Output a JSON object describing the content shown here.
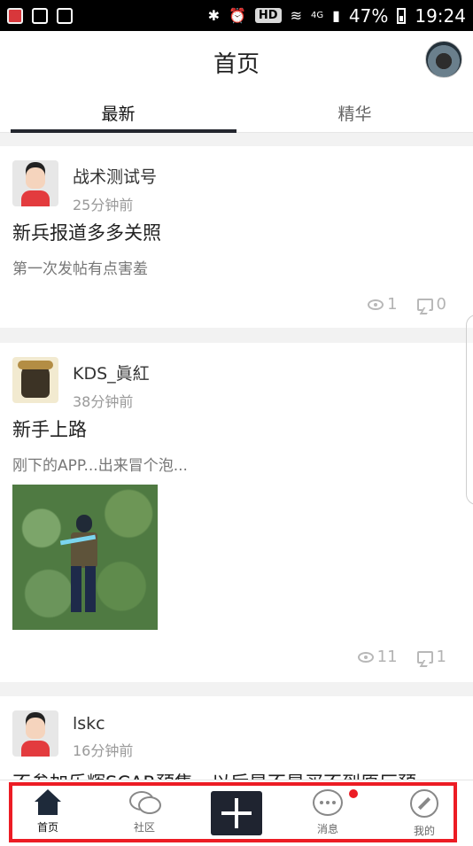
{
  "status_bar": {
    "battery": "47%",
    "time": "19:24",
    "hd": "HD",
    "network": "4G",
    "icons": [
      "app-icon",
      "image-icon",
      "check-clipboard-icon",
      "bluetooth-icon",
      "alarm-icon",
      "wifi-icon",
      "signal-icon",
      "battery-icon"
    ]
  },
  "header": {
    "title": "首页"
  },
  "tabs": [
    {
      "label": "最新",
      "active": true
    },
    {
      "label": "精华",
      "active": false
    }
  ],
  "posts": [
    {
      "author": "战术测试号",
      "time": "25分钟前",
      "title": "新兵报道多多关照",
      "excerpt": "第一次发帖有点害羞",
      "views": "1",
      "comments": "0"
    },
    {
      "author": "KDS_眞紅",
      "time": "38分钟前",
      "title": "新手上路",
      "excerpt": "刚下的APP...出来冒个泡...",
      "views": "11",
      "comments": "1"
    },
    {
      "author": "lskc",
      "time": "16分钟前",
      "title": "不参加乐辉SCAR预售，以后是不是买不到原厂预"
    }
  ],
  "bottom_nav": [
    {
      "label": "首页",
      "active": true
    },
    {
      "label": "社区",
      "active": false
    },
    {
      "label": "",
      "active": false
    },
    {
      "label": "消息",
      "active": false
    },
    {
      "label": "我的",
      "active": false
    }
  ],
  "colors": {
    "accent_dark": "#23262e",
    "notification_red": "#ec1c24",
    "highlight_outline": "#ec1c24"
  }
}
